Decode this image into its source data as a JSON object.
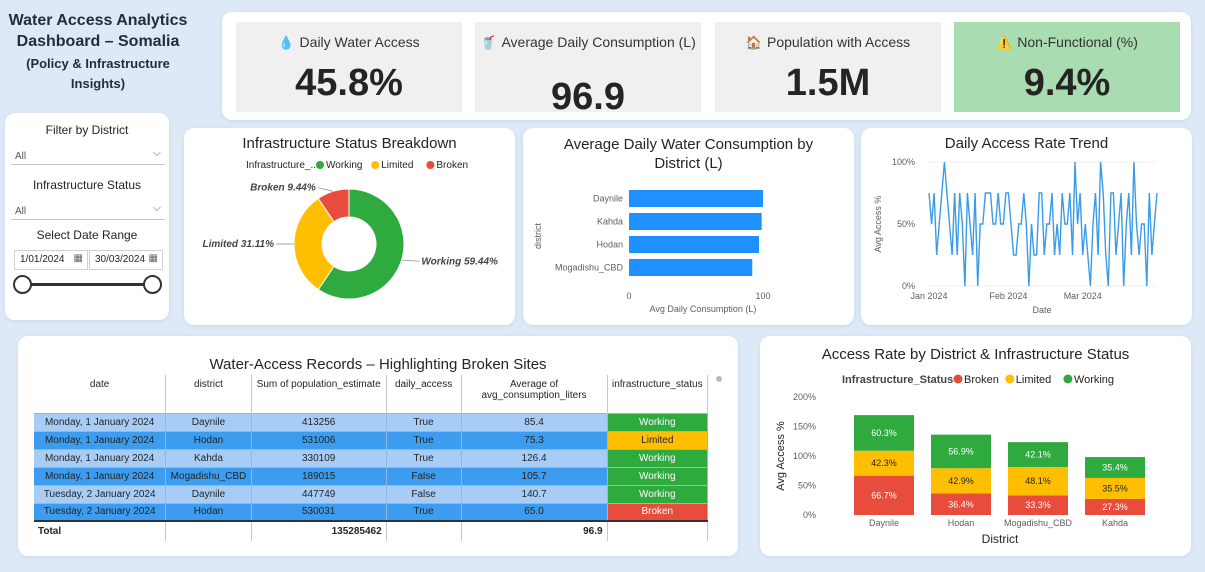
{
  "header": {
    "title_line1": "Water Access Analytics",
    "title_line2": "Dashboard – Somalia",
    "title_line3": "(Policy & Infrastructure",
    "title_line4": "Insights)"
  },
  "kpis": [
    {
      "icon": "water-drop-icon",
      "glyph": "💧",
      "label": "Daily Water Access",
      "value": "45.8%"
    },
    {
      "icon": "cup-icon",
      "glyph": "🥤",
      "label": "Average Daily Consumption (L)",
      "value": "96.9"
    },
    {
      "icon": "house-icon",
      "glyph": "🏠",
      "label": "Population with Access",
      "value": "1.5M"
    },
    {
      "icon": "warning-icon",
      "glyph": "⚠️",
      "label": "Non-Functional (%)",
      "value": "9.4%",
      "highlight": "#a9dcb0"
    }
  ],
  "filters": {
    "district_label": "Filter by District",
    "district_value": "All",
    "infra_label": "Infrastructure Status",
    "infra_value": "All",
    "date_label": "Select Date Range",
    "date_start": "1/01/2024",
    "date_end": "30/03/2024"
  },
  "colors": {
    "working": "#2eaa3e",
    "limited": "#ffbf00",
    "broken": "#e74c3c",
    "bar": "#1e90ff",
    "line": "#3a9be8"
  },
  "chart_data": [
    {
      "type": "pie",
      "title": "Infrastructure Status Breakdown",
      "legend_title": "Infrastructure_...",
      "legend_position": "top",
      "slices": [
        {
          "name": "Working",
          "value": 59.44,
          "label": "Working 59.44%"
        },
        {
          "name": "Limited",
          "value": 31.11,
          "label": "Limited 31.11%"
        },
        {
          "name": "Broken",
          "value": 9.44,
          "label": "Broken 9.44%"
        }
      ],
      "legend": [
        "Working",
        "Limited",
        "Broken"
      ]
    },
    {
      "type": "bar",
      "orientation": "horizontal",
      "title": "Average Daily Water Consumption by District (L)",
      "categories": [
        "Daynile",
        "Kahda",
        "Hodan",
        "Mogadishu_CBD"
      ],
      "values": [
        100,
        99,
        97,
        92
      ],
      "xlabel": "Avg Daily Consumption (L)",
      "ylabel": "district",
      "xlim": [
        0,
        125
      ],
      "xticks": [
        "0",
        "100"
      ]
    },
    {
      "type": "line",
      "title": "Daily Access Rate Trend",
      "xlabel": "Date",
      "ylabel": "Avg Access %",
      "ylim": [
        0,
        100
      ],
      "yticks": [
        "0%",
        "50%",
        "100%"
      ],
      "xticks": [
        "Jan 2024",
        "Feb 2024",
        "Mar 2024"
      ],
      "values": [
        75,
        50,
        75,
        25,
        50,
        75,
        100,
        75,
        50,
        25,
        75,
        25,
        75,
        50,
        0,
        75,
        50,
        25,
        75,
        0,
        50,
        50,
        75,
        75,
        75,
        50,
        50,
        75,
        50,
        50,
        75,
        75,
        50,
        25,
        25,
        50,
        50,
        75,
        50,
        0,
        50,
        25,
        25,
        75,
        75,
        25,
        50,
        50,
        75,
        25,
        50,
        25,
        75,
        50,
        50,
        75,
        25,
        100,
        50,
        75,
        25,
        50,
        25,
        0,
        50,
        75,
        25,
        100,
        75,
        25,
        0,
        75,
        75,
        25,
        50,
        75,
        0,
        50,
        75,
        25,
        100,
        50,
        25,
        50,
        50,
        0,
        75,
        25,
        50,
        75
      ]
    },
    {
      "type": "bar",
      "stacked": true,
      "title": "Access Rate by District & Infrastructure Status",
      "legend_title": "Infrastructure_Status",
      "legend_position": "top",
      "categories": [
        "Daynile",
        "Hodan",
        "Mogadishu_CBD",
        "Kahda"
      ],
      "series": [
        {
          "name": "Broken",
          "values": [
            66.7,
            36.4,
            33.3,
            27.3
          ],
          "labels": [
            "66.7%",
            "36.4%",
            "33.3%",
            "27.3%"
          ]
        },
        {
          "name": "Limited",
          "values": [
            42.3,
            42.9,
            48.1,
            35.5
          ],
          "labels": [
            "42.3%",
            "42.9%",
            "48.1%",
            "35.5%"
          ]
        },
        {
          "name": "Working",
          "values": [
            60.3,
            56.9,
            42.1,
            35.4
          ],
          "labels": [
            "60.3%",
            "56.9%",
            "42.1%",
            "35.4%"
          ]
        }
      ],
      "xlabel": "District",
      "ylabel": "Avg Access %",
      "ylim": [
        0,
        200
      ],
      "yticks": [
        "0%",
        "50%",
        "100%",
        "150%",
        "200%"
      ]
    }
  ],
  "table": {
    "title": "Water-Access Records – Highlighting Broken Sites",
    "columns": [
      "date",
      "district",
      "Sum of population_estimate",
      "daily_access",
      "Average of avg_consumption_liters",
      "infrastructure_status"
    ],
    "rows": [
      [
        "Monday, 1 January 2024",
        "Daynile",
        "413256",
        "True",
        "85.4",
        "Working"
      ],
      [
        "Monday, 1 January 2024",
        "Hodan",
        "531006",
        "True",
        "75.3",
        "Limited"
      ],
      [
        "Monday, 1 January 2024",
        "Kahda",
        "330109",
        "True",
        "126.4",
        "Working"
      ],
      [
        "Monday, 1 January 2024",
        "Mogadishu_CBD",
        "189015",
        "False",
        "105.7",
        "Working"
      ],
      [
        "Tuesday, 2 January 2024",
        "Daynile",
        "447749",
        "False",
        "140.7",
        "Working"
      ],
      [
        "Tuesday, 2 January 2024",
        "Hodan",
        "530031",
        "True",
        "65.0",
        "Broken"
      ]
    ],
    "total_label": "Total",
    "total_population": "135285462",
    "total_consumption": "96.9"
  }
}
